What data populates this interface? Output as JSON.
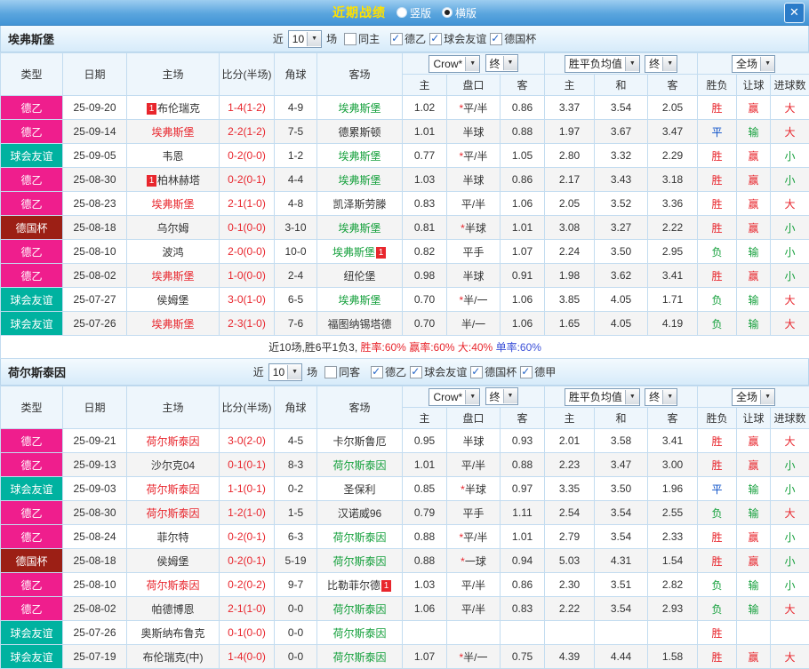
{
  "titlebar": {
    "title": "近期战绩",
    "layout_options": [
      {
        "label": "竖版",
        "selected": false
      },
      {
        "label": "横版",
        "selected": true
      }
    ],
    "close_label": "✕"
  },
  "ui": {
    "near_label": "近",
    "games_label": "场"
  },
  "columns": {
    "type": "类型",
    "date": "日期",
    "home": "主场",
    "score_half": "比分(半场)",
    "corners": "角球",
    "away": "客场",
    "odds_company": "Crow*",
    "final": "终",
    "odds_home": "主",
    "handicap": "盘口",
    "odds_away": "客",
    "avg_label": "胜平负均值",
    "avg_home": "主",
    "avg_draw": "和",
    "avg_away": "客",
    "scope": "全场",
    "result": "胜负",
    "handicap_result": "让球",
    "goals": "进球数"
  },
  "league_colors": {
    "德乙": "#ef1e8d",
    "球会友谊": "#00b2a0",
    "德国杯": "#9c1f15",
    "德甲": "#ef1e8d"
  },
  "value_colors": {
    "胜": "#e8262d",
    "平": "#0b50c8",
    "负": "#15a03c",
    "赢": "#e8262d",
    "输": "#15a03c",
    "走": "#0b50c8",
    "大": "#e8262d",
    "小": "#15a03c"
  },
  "sections": [
    {
      "team": "埃弗斯堡",
      "filters": {
        "games": "10",
        "checkboxes": [
          {
            "label": "同主",
            "checked": false
          },
          {
            "label": "德乙",
            "checked": true
          },
          {
            "label": "球会友谊",
            "checked": true
          },
          {
            "label": "德国杯",
            "checked": true
          }
        ]
      },
      "rows": [
        {
          "league": "德乙",
          "date": "25-09-20",
          "home": "布伦瑞克",
          "home_badge": "1",
          "home_is_focus": false,
          "score": "1-4(1-2)",
          "corners": "4-9",
          "away": "埃弗斯堡",
          "away_badge": "",
          "away_is_focus": true,
          "odds_home": "1.02",
          "handicap": "*平/半",
          "odds_away": "0.86",
          "avg_home": "3.37",
          "avg_draw": "3.54",
          "avg_away": "2.05",
          "result": "胜",
          "handicap_result": "赢",
          "goals": "大"
        },
        {
          "league": "德乙",
          "date": "25-09-14",
          "home": "埃弗斯堡",
          "home_badge": "",
          "home_is_focus": true,
          "score": "2-2(1-2)",
          "corners": "7-5",
          "away": "德累斯顿",
          "away_badge": "",
          "away_is_focus": false,
          "odds_home": "1.01",
          "handicap": "半球",
          "odds_away": "0.88",
          "avg_home": "1.97",
          "avg_draw": "3.67",
          "avg_away": "3.47",
          "result": "平",
          "handicap_result": "输",
          "goals": "大"
        },
        {
          "league": "球会友谊",
          "date": "25-09-05",
          "home": "韦恩",
          "home_badge": "",
          "home_is_focus": false,
          "score": "0-2(0-0)",
          "corners": "1-2",
          "away": "埃弗斯堡",
          "away_badge": "",
          "away_is_focus": true,
          "odds_home": "0.77",
          "handicap": "*平/半",
          "odds_away": "1.05",
          "avg_home": "2.80",
          "avg_draw": "3.32",
          "avg_away": "2.29",
          "result": "胜",
          "handicap_result": "赢",
          "goals": "小"
        },
        {
          "league": "德乙",
          "date": "25-08-30",
          "home": "柏林赫塔",
          "home_badge": "1",
          "home_is_focus": false,
          "score": "0-2(0-1)",
          "corners": "4-4",
          "away": "埃弗斯堡",
          "away_badge": "",
          "away_is_focus": true,
          "odds_home": "1.03",
          "handicap": "半球",
          "odds_away": "0.86",
          "avg_home": "2.17",
          "avg_draw": "3.43",
          "avg_away": "3.18",
          "result": "胜",
          "handicap_result": "赢",
          "goals": "小"
        },
        {
          "league": "德乙",
          "date": "25-08-23",
          "home": "埃弗斯堡",
          "home_badge": "",
          "home_is_focus": true,
          "score": "2-1(1-0)",
          "corners": "4-8",
          "away": "凯泽斯劳滕",
          "away_badge": "",
          "away_is_focus": false,
          "odds_home": "0.83",
          "handicap": "平/半",
          "odds_away": "1.06",
          "avg_home": "2.05",
          "avg_draw": "3.52",
          "avg_away": "3.36",
          "result": "胜",
          "handicap_result": "赢",
          "goals": "大"
        },
        {
          "league": "德国杯",
          "date": "25-08-18",
          "home": "乌尔姆",
          "home_badge": "",
          "home_is_focus": false,
          "score": "0-1(0-0)",
          "corners": "3-10",
          "away": "埃弗斯堡",
          "away_badge": "",
          "away_is_focus": true,
          "odds_home": "0.81",
          "handicap": "*半球",
          "odds_away": "1.01",
          "avg_home": "3.08",
          "avg_draw": "3.27",
          "avg_away": "2.22",
          "result": "胜",
          "handicap_result": "赢",
          "goals": "小"
        },
        {
          "league": "德乙",
          "date": "25-08-10",
          "home": "波鸿",
          "home_badge": "",
          "home_is_focus": false,
          "score": "2-0(0-0)",
          "corners": "10-0",
          "away": "埃弗斯堡",
          "away_badge": "1",
          "away_is_focus": true,
          "odds_home": "0.82",
          "handicap": "平手",
          "odds_away": "1.07",
          "avg_home": "2.24",
          "avg_draw": "3.50",
          "avg_away": "2.95",
          "result": "负",
          "handicap_result": "输",
          "goals": "小"
        },
        {
          "league": "德乙",
          "date": "25-08-02",
          "home": "埃弗斯堡",
          "home_badge": "",
          "home_is_focus": true,
          "score": "1-0(0-0)",
          "corners": "2-4",
          "away": "纽伦堡",
          "away_badge": "",
          "away_is_focus": false,
          "odds_home": "0.98",
          "handicap": "半球",
          "odds_away": "0.91",
          "avg_home": "1.98",
          "avg_draw": "3.62",
          "avg_away": "3.41",
          "result": "胜",
          "handicap_result": "赢",
          "goals": "小"
        },
        {
          "league": "球会友谊",
          "date": "25-07-27",
          "home": "侯姆堡",
          "home_badge": "",
          "home_is_focus": false,
          "score": "3-0(1-0)",
          "corners": "6-5",
          "away": "埃弗斯堡",
          "away_badge": "",
          "away_is_focus": true,
          "odds_home": "0.70",
          "handicap": "*半/一",
          "odds_away": "1.06",
          "avg_home": "3.85",
          "avg_draw": "4.05",
          "avg_away": "1.71",
          "result": "负",
          "handicap_result": "输",
          "goals": "大"
        },
        {
          "league": "球会友谊",
          "date": "25-07-26",
          "home": "埃弗斯堡",
          "home_badge": "",
          "home_is_focus": true,
          "score": "2-3(1-0)",
          "corners": "7-6",
          "away": "福图纳锡塔德",
          "away_badge": "",
          "away_is_focus": false,
          "odds_home": "0.70",
          "handicap": "半/一",
          "odds_away": "1.06",
          "avg_home": "1.65",
          "avg_draw": "4.05",
          "avg_away": "4.19",
          "result": "负",
          "handicap_result": "输",
          "goals": "大"
        }
      ],
      "summary": [
        {
          "text": "近10场,胜6平1负3, ",
          "color": "#333333"
        },
        {
          "text": "胜率:60% ",
          "color": "#e8262d"
        },
        {
          "text": "赢率:60% ",
          "color": "#e8262d"
        },
        {
          "text": "大:40% ",
          "color": "#e8262d"
        },
        {
          "text": "单率:60%",
          "color": "#3a4fd8"
        }
      ]
    },
    {
      "team": "荷尔斯泰因",
      "filters": {
        "games": "10",
        "checkboxes": [
          {
            "label": "同客",
            "checked": false
          },
          {
            "label": "德乙",
            "checked": true
          },
          {
            "label": "球会友谊",
            "checked": true
          },
          {
            "label": "德国杯",
            "checked": true
          },
          {
            "label": "德甲",
            "checked": true
          }
        ]
      },
      "rows": [
        {
          "league": "德乙",
          "date": "25-09-21",
          "home": "荷尔斯泰因",
          "home_badge": "",
          "home_is_focus": true,
          "score": "3-0(2-0)",
          "corners": "4-5",
          "away": "卡尔斯鲁厄",
          "away_badge": "",
          "away_is_focus": false,
          "odds_home": "0.95",
          "handicap": "半球",
          "odds_away": "0.93",
          "avg_home": "2.01",
          "avg_draw": "3.58",
          "avg_away": "3.41",
          "result": "胜",
          "handicap_result": "赢",
          "goals": "大"
        },
        {
          "league": "德乙",
          "date": "25-09-13",
          "home": "沙尔克04",
          "home_badge": "",
          "home_is_focus": false,
          "score": "0-1(0-1)",
          "corners": "8-3",
          "away": "荷尔斯泰因",
          "away_badge": "",
          "away_is_focus": true,
          "odds_home": "1.01",
          "handicap": "平/半",
          "odds_away": "0.88",
          "avg_home": "2.23",
          "avg_draw": "3.47",
          "avg_away": "3.00",
          "result": "胜",
          "handicap_result": "赢",
          "goals": "小"
        },
        {
          "league": "球会友谊",
          "date": "25-09-03",
          "home": "荷尔斯泰因",
          "home_badge": "",
          "home_is_focus": true,
          "score": "1-1(0-1)",
          "corners": "0-2",
          "away": "圣保利",
          "away_badge": "",
          "away_is_focus": false,
          "odds_home": "0.85",
          "handicap": "*半球",
          "odds_away": "0.97",
          "avg_home": "3.35",
          "avg_draw": "3.50",
          "avg_away": "1.96",
          "result": "平",
          "handicap_result": "输",
          "goals": "小"
        },
        {
          "league": "德乙",
          "date": "25-08-30",
          "home": "荷尔斯泰因",
          "home_badge": "",
          "home_is_focus": true,
          "score": "1-2(1-0)",
          "corners": "1-5",
          "away": "汉诺威96",
          "away_badge": "",
          "away_is_focus": false,
          "odds_home": "0.79",
          "handicap": "平手",
          "odds_away": "1.11",
          "avg_home": "2.54",
          "avg_draw": "3.54",
          "avg_away": "2.55",
          "result": "负",
          "handicap_result": "输",
          "goals": "大"
        },
        {
          "league": "德乙",
          "date": "25-08-24",
          "home": "菲尔特",
          "home_badge": "",
          "home_is_focus": false,
          "score": "0-2(0-1)",
          "corners": "6-3",
          "away": "荷尔斯泰因",
          "away_badge": "",
          "away_is_focus": true,
          "odds_home": "0.88",
          "handicap": "*平/半",
          "odds_away": "1.01",
          "avg_home": "2.79",
          "avg_draw": "3.54",
          "avg_away": "2.33",
          "result": "胜",
          "handicap_result": "赢",
          "goals": "小"
        },
        {
          "league": "德国杯",
          "date": "25-08-18",
          "home": "侯姆堡",
          "home_badge": "",
          "home_is_focus": false,
          "score": "0-2(0-1)",
          "corners": "5-19",
          "away": "荷尔斯泰因",
          "away_badge": "",
          "away_is_focus": true,
          "odds_home": "0.88",
          "handicap": "*一球",
          "odds_away": "0.94",
          "avg_home": "5.03",
          "avg_draw": "4.31",
          "avg_away": "1.54",
          "result": "胜",
          "handicap_result": "赢",
          "goals": "小"
        },
        {
          "league": "德乙",
          "date": "25-08-10",
          "home": "荷尔斯泰因",
          "home_badge": "",
          "home_is_focus": true,
          "score": "0-2(0-2)",
          "corners": "9-7",
          "away": "比勒菲尔德",
          "away_badge": "1",
          "away_is_focus": false,
          "odds_home": "1.03",
          "handicap": "平/半",
          "odds_away": "0.86",
          "avg_home": "2.30",
          "avg_draw": "3.51",
          "avg_away": "2.82",
          "result": "负",
          "handicap_result": "输",
          "goals": "小"
        },
        {
          "league": "德乙",
          "date": "25-08-02",
          "home": "帕德博恩",
          "home_badge": "",
          "home_is_focus": false,
          "score": "2-1(1-0)",
          "corners": "0-0",
          "away": "荷尔斯泰因",
          "away_badge": "",
          "away_is_focus": true,
          "odds_home": "1.06",
          "handicap": "平/半",
          "odds_away": "0.83",
          "avg_home": "2.22",
          "avg_draw": "3.54",
          "avg_away": "2.93",
          "result": "负",
          "handicap_result": "输",
          "goals": "大"
        },
        {
          "league": "球会友谊",
          "date": "25-07-26",
          "home": "奥斯纳布鲁克",
          "home_badge": "",
          "home_is_focus": false,
          "score": "0-1(0-0)",
          "corners": "0-0",
          "away": "荷尔斯泰因",
          "away_badge": "",
          "away_is_focus": true,
          "odds_home": "",
          "handicap": "",
          "odds_away": "",
          "avg_home": "",
          "avg_draw": "",
          "avg_away": "",
          "result": "胜",
          "handicap_result": "",
          "goals": ""
        },
        {
          "league": "球会友谊",
          "date": "25-07-19",
          "home": "布伦瑞克(中)",
          "home_badge": "",
          "home_is_focus": false,
          "score": "1-4(0-0)",
          "corners": "0-0",
          "away": "荷尔斯泰因",
          "away_badge": "",
          "away_is_focus": true,
          "odds_home": "1.07",
          "handicap": "*半/一",
          "odds_away": "0.75",
          "avg_home": "4.39",
          "avg_draw": "4.44",
          "avg_away": "1.58",
          "result": "胜",
          "handicap_result": "赢",
          "goals": "大"
        }
      ]
    }
  ]
}
